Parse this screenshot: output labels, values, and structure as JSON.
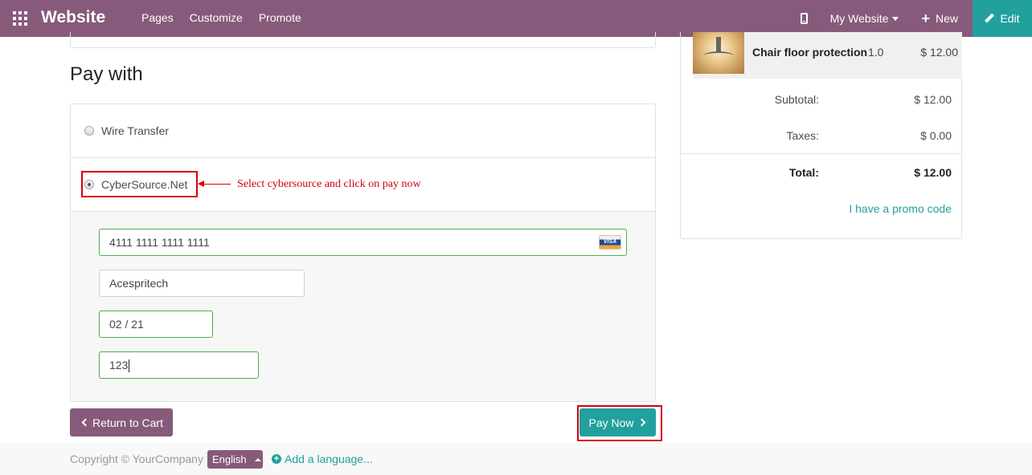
{
  "navbar": {
    "brand": "Website",
    "links": [
      "Pages",
      "Customize",
      "Promote"
    ],
    "my_website": "My Website",
    "new_label": "New",
    "edit_label": "Edit",
    "color": "#875a7b",
    "edit_color": "#21a09e"
  },
  "payment": {
    "title": "Pay with",
    "options": [
      {
        "label": "Wire Transfer",
        "selected": false
      },
      {
        "label": "CyberSource.Net",
        "selected": true
      }
    ],
    "annotation": "Select cybersource and click on pay now",
    "fields": {
      "card_number": "4111 1111 1111 1111",
      "card_brand": "VISA",
      "holder_name": "Acespritech",
      "expiry": "02 / 21",
      "cvc": "123"
    },
    "return_label": "Return to Cart",
    "pay_label": "Pay Now"
  },
  "summary": {
    "item": {
      "name": "Chair floor protection",
      "qty": "1.0",
      "price": "$ 12.00"
    },
    "subtotal_label": "Subtotal:",
    "subtotal_value": "$ 12.00",
    "taxes_label": "Taxes:",
    "taxes_value": "$ 0.00",
    "total_label": "Total:",
    "total_value": "$ 12.00",
    "promo_label": "I have a promo code"
  },
  "footer": {
    "copyright": "Copyright © YourCompany",
    "language": "English",
    "add_language": "Add a language..."
  }
}
